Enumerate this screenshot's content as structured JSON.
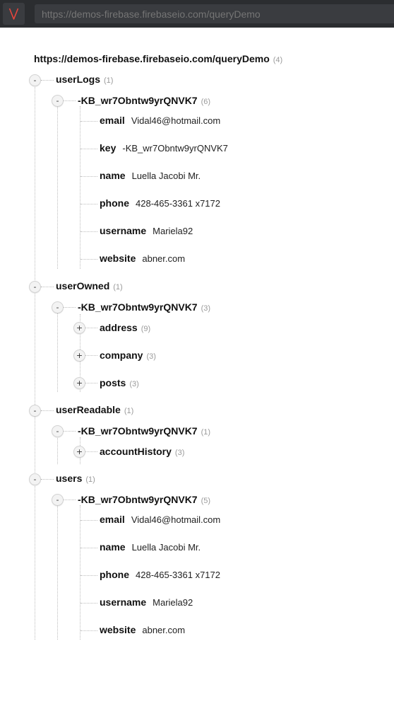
{
  "app": {
    "url_placeholder": "https://demos-firebase.firebaseio.com/queryDemo",
    "colors": {
      "topbar": "#2b2d30",
      "logo_accent": "#e8453c",
      "count": "#9a9a9a"
    }
  },
  "tree": {
    "root": {
      "label": "https://demos-firebase.firebaseio.com/queryDemo",
      "count": "(4)"
    },
    "userLogs": {
      "label": "userLogs",
      "count": "(1)",
      "toggle": "-",
      "child": {
        "label": "-KB_wr7Obntw9yrQNVK7",
        "count": "(6)",
        "toggle": "-",
        "fields": [
          {
            "key": "email",
            "value": "Vidal46@hotmail.com"
          },
          {
            "key": "key",
            "value": "-KB_wr7Obntw9yrQNVK7"
          },
          {
            "key": "name",
            "value": "Luella Jacobi Mr."
          },
          {
            "key": "phone",
            "value": "428-465-3361 x7172"
          },
          {
            "key": "username",
            "value": "Mariela92"
          },
          {
            "key": "website",
            "value": "abner.com"
          }
        ]
      }
    },
    "userOwned": {
      "label": "userOwned",
      "count": "(1)",
      "toggle": "-",
      "child": {
        "label": "-KB_wr7Obntw9yrQNVK7",
        "count": "(3)",
        "toggle": "-",
        "nodes": [
          {
            "label": "address",
            "count": "(9)",
            "toggle": "+"
          },
          {
            "label": "company",
            "count": "(3)",
            "toggle": "+"
          },
          {
            "label": "posts",
            "count": "(3)",
            "toggle": "+"
          }
        ]
      }
    },
    "userReadable": {
      "label": "userReadable",
      "count": "(1)",
      "toggle": "-",
      "child": {
        "label": "-KB_wr7Obntw9yrQNVK7",
        "count": "(1)",
        "toggle": "-",
        "nodes": [
          {
            "label": "accountHistory",
            "count": "(3)",
            "toggle": "+"
          }
        ]
      }
    },
    "users": {
      "label": "users",
      "count": "(1)",
      "toggle": "-",
      "child": {
        "label": "-KB_wr7Obntw9yrQNVK7",
        "count": "(5)",
        "toggle": "-",
        "fields": [
          {
            "key": "email",
            "value": "Vidal46@hotmail.com"
          },
          {
            "key": "name",
            "value": "Luella Jacobi Mr."
          },
          {
            "key": "phone",
            "value": "428-465-3361 x7172"
          },
          {
            "key": "username",
            "value": "Mariela92"
          },
          {
            "key": "website",
            "value": "abner.com"
          }
        ]
      }
    }
  }
}
